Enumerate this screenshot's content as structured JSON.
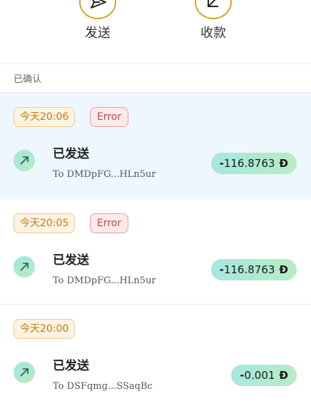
{
  "actions": {
    "send_label": "发送",
    "receive_label": "收款"
  },
  "section_title": "已确认",
  "transactions": [
    {
      "time": "今天20:06",
      "status": "Error",
      "title": "已发送",
      "address": "To DMDpFG...HLn5ur",
      "amount_sign": "-",
      "amount": "116.8763",
      "unit": "Đ"
    },
    {
      "time": "今天20:05",
      "status": "Error",
      "title": "已发送",
      "address": "To DMDpFG...HLn5ur",
      "amount_sign": "-",
      "amount": "116.8763",
      "unit": "Đ"
    },
    {
      "time": "今天20:00",
      "status": "",
      "title": "已发送",
      "address": "To DSFqmg...SSaqBc",
      "amount_sign": "-",
      "amount": "0.001",
      "unit": "Đ"
    }
  ],
  "icons": {
    "send": "send-arrow-icon",
    "receive": "receive-arrow-icon",
    "outgoing": "arrow-up-right-icon"
  },
  "colors": {
    "action_ring": "#d9a520",
    "time_badge_text": "#c47a1b",
    "error_badge_text": "#c74545",
    "highlight_row": "#eef7fd",
    "amount_pill": "#a7e6e2"
  }
}
